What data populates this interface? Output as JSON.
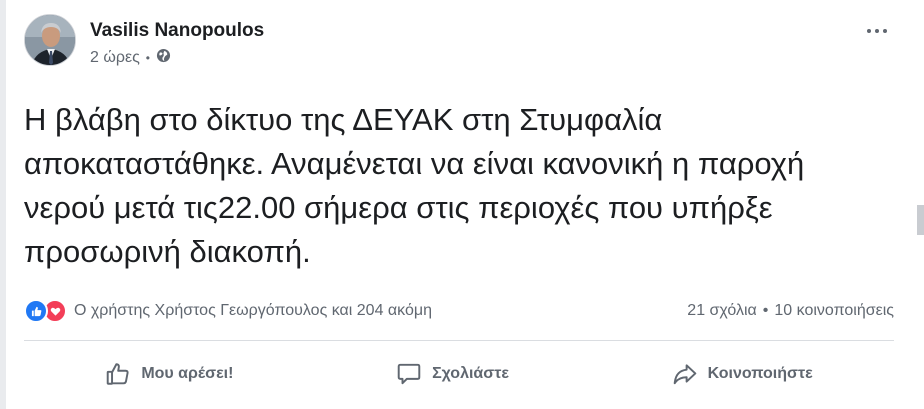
{
  "post": {
    "author": "Vasilis Nanopoulos",
    "time": "2 ώρες",
    "separator": "•",
    "audience_icon": "globe-icon",
    "text": "Η βλάβη στο δίκτυο της ΔΕΥΑΚ στη Στυμφαλία αποκαταστάθηκε. Αναμένεται να είναι κανονική η παροχή νερού μετά τις22.00 σήμερα στις περιοχές που υπήρξε προσωρινή διακοπή.",
    "more_icon": "more-options-icon"
  },
  "reactions": {
    "icons": [
      "like-reaction-icon",
      "love-reaction-icon"
    ],
    "summary": "Ο χρήστης Χρήστος Γεωργόπουλος και 204 ακόμη",
    "comments": "21 σχόλια",
    "separator": "•",
    "shares": "10 κοινοποιήσεις"
  },
  "actions": {
    "like_label": "Μου αρέσει!",
    "comment_label": "Σχολιάστε",
    "share_label": "Κοινοποιήστε"
  },
  "colors": {
    "like_blue": "#2078f4",
    "love_red": "#f33e58",
    "secondary_text": "#606770",
    "primary_text": "#1c1e21"
  }
}
